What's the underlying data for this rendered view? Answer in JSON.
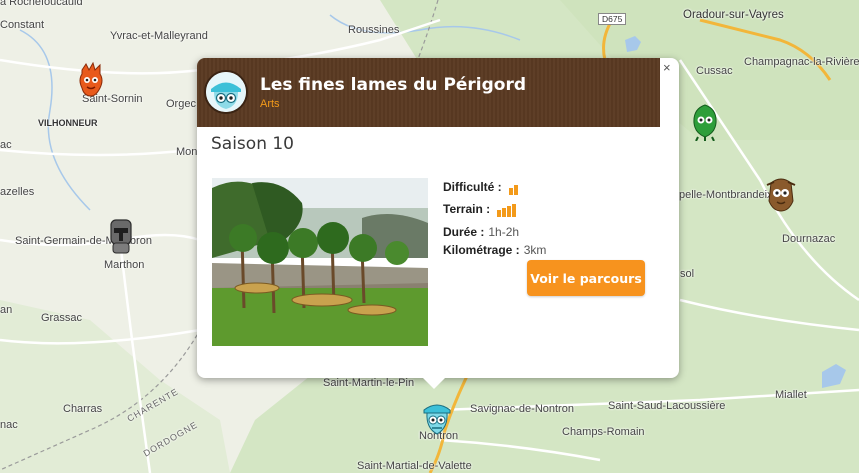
{
  "map": {
    "places": [
      {
        "id": "rochefoucauld",
        "label": "a Rochefoucauld"
      },
      {
        "id": "constant",
        "label": "Constant"
      },
      {
        "id": "yvrac",
        "label": "Yvrac-et-Malleyrand"
      },
      {
        "id": "roussines",
        "label": "Roussines"
      },
      {
        "id": "oradour",
        "label": "Oradour-sur-Vayres"
      },
      {
        "id": "saint-sornin",
        "label": "Saint-Sornin"
      },
      {
        "id": "orgec",
        "label": "Orgec"
      },
      {
        "id": "cussac",
        "label": "Cussac"
      },
      {
        "id": "champagnac",
        "label": "Champagnac-la-Rivière"
      },
      {
        "id": "vilhonneur",
        "label": "VILHONNEUR"
      },
      {
        "id": "mon",
        "label": "Mon"
      },
      {
        "id": "ac",
        "label": "ac"
      },
      {
        "id": "azelles",
        "label": "azelles"
      },
      {
        "id": "montbrandeix",
        "label": "pelle-Montbrandeix"
      },
      {
        "id": "saint-germain",
        "label": "Saint-Germain-de-Montbron"
      },
      {
        "id": "marthon",
        "label": "Marthon"
      },
      {
        "id": "dournazac",
        "label": "Dournazac"
      },
      {
        "id": "sol",
        "label": "sol"
      },
      {
        "id": "an",
        "label": "an"
      },
      {
        "id": "grassac",
        "label": "Grassac"
      },
      {
        "id": "saint-martin",
        "label": "Saint-Martin-le-Pin"
      },
      {
        "id": "charras",
        "label": "Charras"
      },
      {
        "id": "savignac",
        "label": "Savignac-de-Nontron"
      },
      {
        "id": "saint-saud",
        "label": "Saint-Saud-Lacoussière"
      },
      {
        "id": "miallet",
        "label": "Miallet"
      },
      {
        "id": "nontron",
        "label": "Nontron"
      },
      {
        "id": "champs-romain",
        "label": "Champs-Romain"
      },
      {
        "id": "nac",
        "label": "nac"
      },
      {
        "id": "saint-martial",
        "label": "Saint-Martial-de-Valette"
      }
    ],
    "regions": {
      "charente": "CHARENTE",
      "dordogne": "DORDOGNE"
    },
    "road_shield": "D675",
    "colors": {
      "accent": "#f7931e",
      "header": "#5a3a22",
      "road": "#f2b63a",
      "water": "#a7c8ea"
    }
  },
  "popup": {
    "title": "Les fines lames du Périgord",
    "category": "Arts",
    "season": "Saison 10",
    "close_label": "×",
    "difficulty_label": "Difficulté :",
    "difficulty_level": 2,
    "difficulty_max": 5,
    "terrain_label": "Terrain :",
    "terrain_level": 4,
    "terrain_max": 5,
    "duration_label": "Durée :",
    "duration_value": "1h-2h",
    "distance_label": "Kilométrage :",
    "distance_value": "3km",
    "button_label": "Voir le parcours"
  }
}
